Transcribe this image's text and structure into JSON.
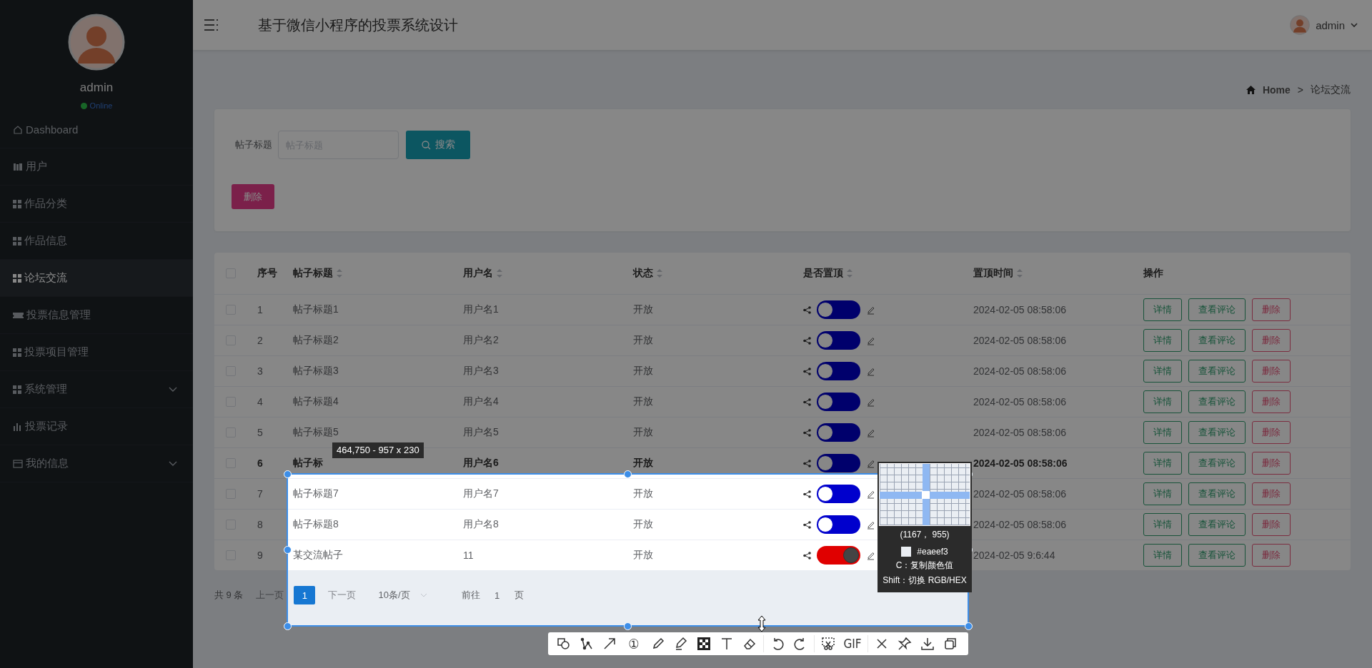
{
  "sidebar": {
    "user": {
      "name": "admin",
      "status": "Online"
    },
    "menu": [
      {
        "label": "Dashboard",
        "selected": false,
        "has_submenu": false
      },
      {
        "label": "用户",
        "selected": false,
        "has_submenu": false
      },
      {
        "label": "作品分类",
        "selected": false,
        "has_submenu": false
      },
      {
        "label": "作品信息",
        "selected": false,
        "has_submenu": false
      },
      {
        "label": "论坛交流",
        "selected": true,
        "has_submenu": false
      },
      {
        "label": "投票信息管理",
        "selected": false,
        "has_submenu": false
      },
      {
        "label": "投票项目管理",
        "selected": false,
        "has_submenu": false
      },
      {
        "label": "系统管理",
        "selected": false,
        "has_submenu": true
      },
      {
        "label": "投票记录",
        "selected": false,
        "has_submenu": false
      },
      {
        "label": "我的信息",
        "selected": false,
        "has_submenu": true
      }
    ]
  },
  "header": {
    "title": "基于微信小程序的投票系统设计",
    "user": "admin"
  },
  "breadcrumb": {
    "home": "Home",
    "separator": ">",
    "current": "论坛交流"
  },
  "search": {
    "label": "帖子标题",
    "placeholder": "帖子标题",
    "button": "搜索",
    "delete_button": "删除"
  },
  "table": {
    "select_all": {
      "checked": false
    },
    "columns": [
      {
        "label": "序号",
        "sortable": false
      },
      {
        "label": "帖子标题",
        "sortable": true
      },
      {
        "label": "用户名",
        "sortable": true
      },
      {
        "label": "状态",
        "sortable": true
      },
      {
        "label": "是否置顶",
        "sortable": true
      },
      {
        "label": "置顶时间",
        "sortable": true
      },
      {
        "label": "操作",
        "sortable": false
      }
    ],
    "rows": [
      {
        "checked": false,
        "bold": false,
        "index": "1",
        "title": "帖子标题1",
        "user": "用户名1",
        "status": "开放",
        "pinned": false,
        "pinned_time": "2024-02-05 08:58:06",
        "actions": [
          {
            "label": "详情",
            "kind": "plain"
          },
          {
            "label": "查看评论",
            "kind": "plain"
          },
          {
            "label": "删除",
            "kind": "danger"
          }
        ]
      },
      {
        "checked": false,
        "bold": false,
        "index": "2",
        "title": "帖子标题2",
        "user": "用户名2",
        "status": "开放",
        "pinned": false,
        "pinned_time": "2024-02-05 08:58:06",
        "actions": [
          {
            "label": "详情",
            "kind": "plain"
          },
          {
            "label": "查看评论",
            "kind": "plain"
          },
          {
            "label": "删除",
            "kind": "danger"
          }
        ]
      },
      {
        "checked": false,
        "bold": false,
        "index": "3",
        "title": "帖子标题3",
        "user": "用户名3",
        "status": "开放",
        "pinned": false,
        "pinned_time": "2024-02-05 08:58:06",
        "actions": [
          {
            "label": "详情",
            "kind": "plain"
          },
          {
            "label": "查看评论",
            "kind": "plain"
          },
          {
            "label": "删除",
            "kind": "danger"
          }
        ]
      },
      {
        "checked": false,
        "bold": false,
        "index": "4",
        "title": "帖子标题4",
        "user": "用户名4",
        "status": "开放",
        "pinned": false,
        "pinned_time": "2024-02-05 08:58:06",
        "actions": [
          {
            "label": "详情",
            "kind": "plain"
          },
          {
            "label": "查看评论",
            "kind": "plain"
          },
          {
            "label": "删除",
            "kind": "danger"
          }
        ]
      },
      {
        "checked": false,
        "bold": false,
        "index": "5",
        "title": "帖子标题5",
        "user": "用户名5",
        "status": "开放",
        "pinned": false,
        "pinned_time": "2024-02-05 08:58:06",
        "actions": [
          {
            "label": "详情",
            "kind": "plain"
          },
          {
            "label": "查看评论",
            "kind": "plain"
          },
          {
            "label": "删除",
            "kind": "danger"
          }
        ]
      },
      {
        "checked": false,
        "bold": true,
        "index": "6",
        "title": "帖子标",
        "user": "用户名6",
        "status": "开放",
        "pinned": false,
        "pinned_time": "2024-02-05 08:58:06",
        "actions": [
          {
            "label": "详情",
            "kind": "plain"
          },
          {
            "label": "查看评论",
            "kind": "plain"
          },
          {
            "label": "删除",
            "kind": "danger"
          }
        ]
      },
      {
        "checked": false,
        "bold": false,
        "index": "7",
        "title": "帖子标题7",
        "user": "用户名7",
        "status": "开放",
        "pinned": false,
        "pinned_time": "2024-02-05 08:58:06",
        "actions": [
          {
            "label": "详情",
            "kind": "plain"
          },
          {
            "label": "查看评论",
            "kind": "plain"
          },
          {
            "label": "删除",
            "kind": "danger"
          }
        ]
      },
      {
        "checked": false,
        "bold": false,
        "index": "8",
        "title": "帖子标题8",
        "user": "用户名8",
        "status": "开放",
        "pinned": false,
        "pinned_time": "2024-02-05 08:58:06",
        "actions": [
          {
            "label": "详情",
            "kind": "plain"
          },
          {
            "label": "查看评论",
            "kind": "plain"
          },
          {
            "label": "删除",
            "kind": "danger"
          }
        ]
      },
      {
        "checked": false,
        "bold": false,
        "index": "9",
        "title": "某交流帖子",
        "user": "11",
        "status": "开放",
        "pinned": true,
        "pinned_time": "2024-02-05 9:6:44",
        "actions": [
          {
            "label": "详情",
            "kind": "plain"
          },
          {
            "label": "查看评论",
            "kind": "plain"
          },
          {
            "label": "删除",
            "kind": "danger"
          }
        ]
      }
    ]
  },
  "pagination": {
    "total": "共 9 条",
    "prev": "上一页",
    "pages": [
      {
        "label": "1",
        "selected": true
      }
    ],
    "next": "下一页",
    "page_size": "10条/页",
    "goto": "前往",
    "goto_value": "1",
    "page_unit": "页"
  },
  "snip": {
    "size_label": "464,750 - 957 x 230",
    "magnifier": {
      "coords": "(1167， 955)",
      "color": "#eaeef3",
      "hint_copy": "C：复制颜色值",
      "hint_switch": "Shift：切换 RGB/HEX"
    },
    "toolbar": {
      "number_tool": "①",
      "gif_tool": "GIF"
    }
  }
}
